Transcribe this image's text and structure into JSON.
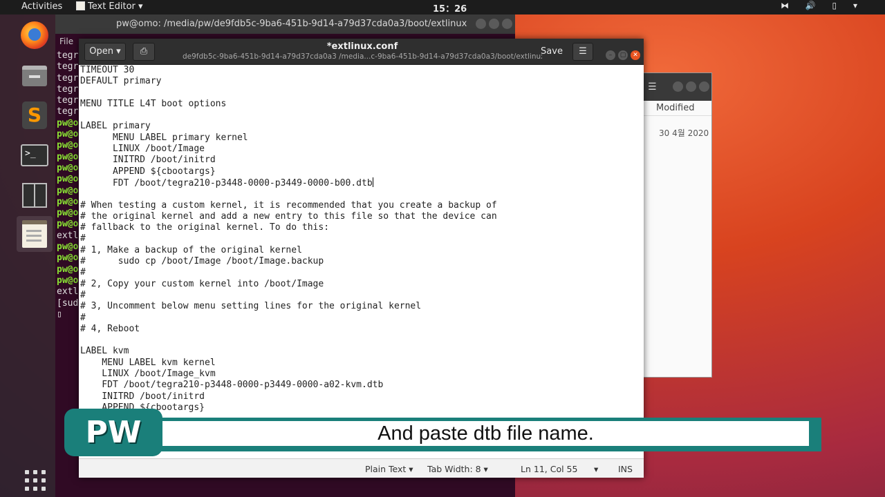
{
  "topbar": {
    "activities": "Activities",
    "app_menu": "Text Editor ▾",
    "clock": "15：26",
    "tray": "⧓ 🔊 ▯ ▾"
  },
  "dock": {
    "items": [
      "firefox",
      "files",
      "sublime-text",
      "terminal",
      "split-terminal",
      "text-editor"
    ]
  },
  "terminal": {
    "title": "pw@omo: /media/pw/de9fdb5c-9ba6-451b-9d14-a79d37cda0a3/boot/extlinux",
    "menu": "File",
    "lines": [
      "tegr",
      "tegr",
      "tegr",
      "tegr",
      "tegr",
      "tegr",
      "pw@o",
      "pw@o",
      "pw@o",
      "pw@o",
      "pw@o",
      "pw@o",
      "pw@o",
      "pw@o",
      "pw@o",
      "pw@o",
      "extl",
      "pw@o",
      "pw@o",
      "pw@o",
      "pw@o",
      "extl",
      "[sud",
      "▯"
    ]
  },
  "files": {
    "column_header": "Modified",
    "date": "30 4월 2020",
    "menu_icon": "☰"
  },
  "editor": {
    "open_label": "Open ▾",
    "title": "*extlinux.conf",
    "subtitle": "de9fdb5c-9ba6-451b-9d14-a79d37cda0a3 /media...c-9ba6-451b-9d14-a79d37cda0a3/boot/extlinux",
    "save_label": "Save",
    "menu_label": "☰",
    "lines": [
      "TIMEOUT 30",
      "DEFAULT primary",
      "",
      "MENU TITLE L4T boot options",
      "",
      "LABEL primary",
      "      MENU LABEL primary kernel",
      "      LINUX /boot/Image",
      "      INITRD /boot/initrd",
      "      APPEND ${cbootargs}",
      "      FDT /boot/tegra210-p3448-0000-p3449-0000-b00.dtb",
      "",
      "# When testing a custom kernel, it is recommended that you create a backup of",
      "# the original kernel and add a new entry to this file so that the device can",
      "# fallback to the original kernel. To do this:",
      "#",
      "# 1, Make a backup of the original kernel",
      "#      sudo cp /boot/Image /boot/Image.backup",
      "#",
      "# 2, Copy your custom kernel into /boot/Image",
      "#",
      "# 3, Uncomment below menu setting lines for the original kernel",
      "#",
      "# 4, Reboot",
      "",
      "LABEL kvm",
      "    MENU LABEL kvm kernel",
      "    LINUX /boot/Image_kvm",
      "    FDT /boot/tegra210-p3448-0000-p3449-0000-a02-kvm.dtb",
      "    INITRD /boot/initrd",
      "    APPEND ${cbootargs}"
    ],
    "status": {
      "language": "Plain Text ▾",
      "tab_width": "Tab Width: 8 ▾",
      "position": "Ln 11, Col 55",
      "position_dropdown": "▾",
      "mode": "INS"
    }
  },
  "caption": {
    "logo": "PW",
    "text": "And paste dtb file name."
  }
}
